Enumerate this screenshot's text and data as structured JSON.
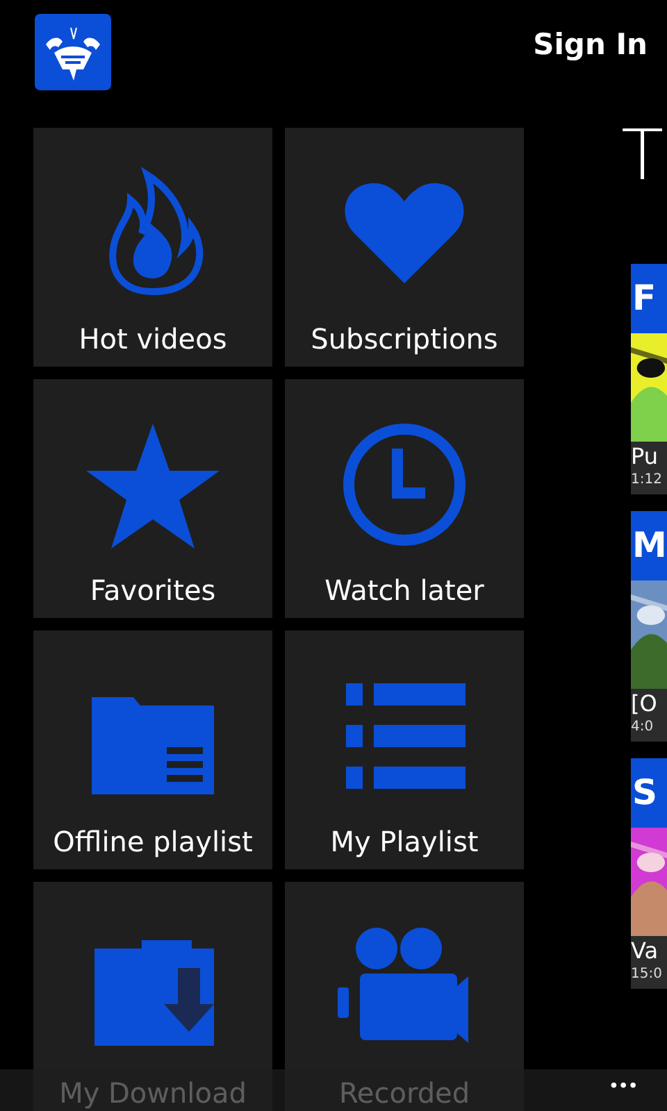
{
  "header": {
    "sign_in": "Sign In"
  },
  "tiles": [
    {
      "kind": "flame",
      "label": "Hot videos"
    },
    {
      "kind": "heart",
      "label": "Subscriptions"
    },
    {
      "kind": "star",
      "label": "Favorites"
    },
    {
      "kind": "clock",
      "label": "Watch later"
    },
    {
      "kind": "offline",
      "label": "Offline playlist"
    },
    {
      "kind": "numbered",
      "label": "My Playlist"
    },
    {
      "kind": "download",
      "label": "My Download"
    },
    {
      "kind": "camera",
      "label": "Recorded"
    }
  ],
  "side_panel": {
    "title": "T",
    "sections": [
      {
        "header": "F",
        "video": {
          "kind": "picture",
          "title": "Pu",
          "duration": "1:12"
        }
      },
      {
        "header": "M",
        "video": {
          "kind": "picture",
          "title": "[O",
          "duration": "4:0"
        }
      },
      {
        "header": "S",
        "video": {
          "kind": "picture",
          "title": "Va",
          "duration": "15:0"
        }
      }
    ]
  },
  "app_bar": {
    "more": "•••"
  }
}
